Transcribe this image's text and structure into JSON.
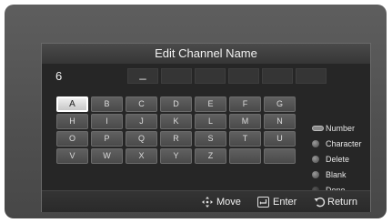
{
  "dialog": {
    "title": "Edit Channel Name",
    "channel_number": "6",
    "name_slots": [
      "_",
      "",
      "",
      "",
      "",
      ""
    ]
  },
  "keyboard": {
    "rows": [
      [
        "A",
        "B",
        "C",
        "D",
        "E",
        "F",
        "G"
      ],
      [
        "H",
        "I",
        "J",
        "K",
        "L",
        "M",
        "N"
      ],
      [
        "O",
        "P",
        "Q",
        "R",
        "S",
        "T",
        "U"
      ],
      [
        "V",
        "W",
        "X",
        "Y",
        "Z",
        "",
        ""
      ]
    ],
    "selected": "A"
  },
  "options": [
    {
      "label": "Number",
      "icon": "number-button-icon"
    },
    {
      "label": "Character",
      "icon": "dot-icon"
    },
    {
      "label": "Delete",
      "icon": "dot-icon"
    },
    {
      "label": "Blank",
      "icon": "dot-icon"
    },
    {
      "label": "Done",
      "icon": "dot-icon"
    }
  ],
  "footer": {
    "move": "Move",
    "enter": "Enter",
    "return": "Return"
  },
  "colors": {
    "frame": "#555555",
    "dialog_bg": "#262626",
    "key": "#555555",
    "key_selected": "#e6e6e6"
  }
}
